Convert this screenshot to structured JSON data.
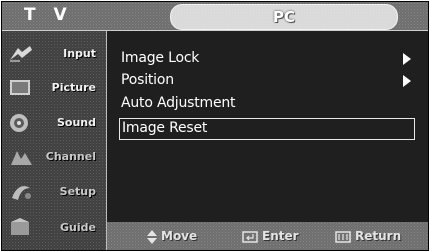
{
  "header": {
    "source_title": "T V",
    "menu_title": "PC"
  },
  "sidebar": {
    "items": [
      {
        "label": "Input",
        "icon": "input-icon"
      },
      {
        "label": "Picture",
        "icon": "picture-icon"
      },
      {
        "label": "Sound",
        "icon": "sound-icon"
      },
      {
        "label": "Channel",
        "icon": "channel-icon"
      },
      {
        "label": "Setup",
        "icon": "setup-icon"
      },
      {
        "label": "Guide",
        "icon": "guide-icon"
      }
    ]
  },
  "menu": {
    "items": [
      {
        "label": "Image Lock",
        "has_submenu": true,
        "selected": false
      },
      {
        "label": "Position",
        "has_submenu": true,
        "selected": false
      },
      {
        "label": "Auto Adjustment",
        "has_submenu": false,
        "selected": false
      },
      {
        "label": "Image Reset",
        "has_submenu": false,
        "selected": true
      }
    ]
  },
  "footer": {
    "move_label": "Move",
    "enter_label": "Enter",
    "return_label": "Return"
  },
  "colors": {
    "background": "#1f1f1f",
    "bar": "#6a6a6a",
    "text": "#ffffff"
  }
}
